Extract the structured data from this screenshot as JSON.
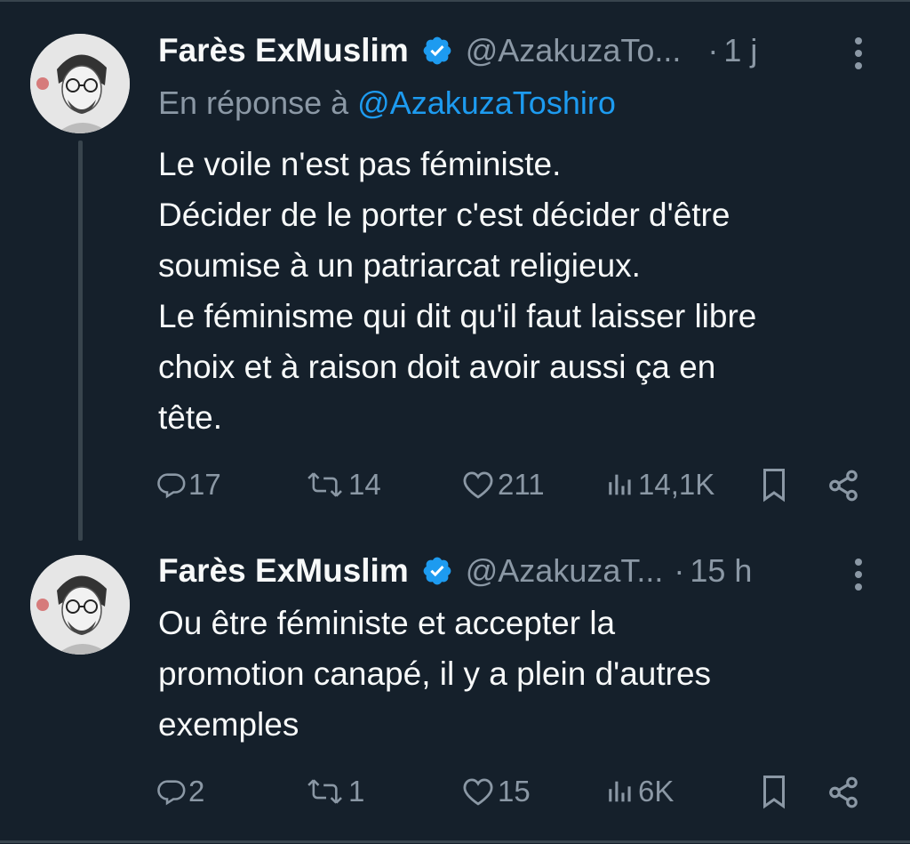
{
  "tweets": [
    {
      "author_name": "Farès ExMuslim",
      "handle": "@AzakuzaTo...",
      "separator": "·",
      "time": "1 j",
      "reply_prefix": "En réponse à",
      "reply_mention": "@AzakuzaToshiro",
      "text_lines": [
        "Le voile n'est pas féministe.",
        "Décider de le porter c'est décider d'être",
        "soumise à un patriarcat religieux.",
        "Le féminisme qui dit qu'il faut laisser libre",
        "choix et à raison doit avoir aussi ça en",
        "tête."
      ],
      "stats": {
        "replies": "17",
        "reposts": "14",
        "likes": "211",
        "views": "14,1K"
      }
    },
    {
      "author_name": "Farès ExMuslim",
      "handle": "@AzakuzaT...",
      "separator": "·",
      "time": "15 h",
      "text_lines": [
        "Ou être féministe et accepter la",
        "promotion canapé, il y a plein d'autres",
        "exemples"
      ],
      "stats": {
        "replies": "2",
        "reposts": "1",
        "likes": "15",
        "views": "6K"
      }
    }
  ],
  "icons": {
    "verified": "verified-badge-icon",
    "reply": "reply-icon",
    "repost": "repost-icon",
    "like": "heart-icon",
    "views": "views-icon",
    "bookmark": "bookmark-icon",
    "share": "share-icon",
    "more": "more-icon"
  },
  "colors": {
    "background": "#15202b",
    "text": "#f7f9f9",
    "secondary": "#8b98a5",
    "link": "#1d9bf0",
    "border": "#38444d"
  }
}
